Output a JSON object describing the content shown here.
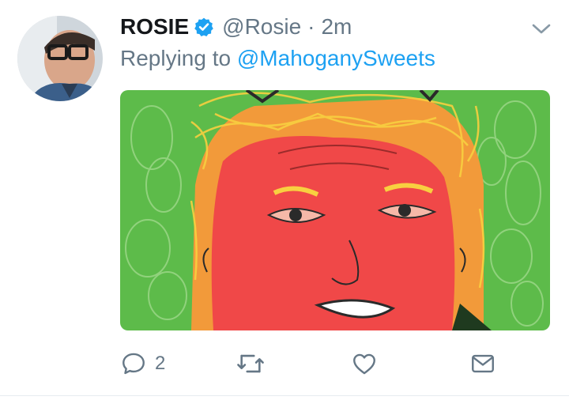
{
  "tweet": {
    "display_name": "ROSIE",
    "handle": "@Rosie",
    "separator": "·",
    "time": "2m",
    "replying_prefix": "Replying to ",
    "replying_to": "@MahoganySweets",
    "reply_count": "2",
    "icons": {
      "verified": "verified-badge-icon",
      "more": "chevron-down-icon",
      "reply": "reply-bubble-icon",
      "retweet": "retweet-icon",
      "like": "heart-icon",
      "dm": "envelope-icon"
    },
    "colors": {
      "link": "#1da1f2",
      "muted": "#657786",
      "text": "#14171a",
      "media_green": "#5dbb4a",
      "face_red": "#f04848",
      "hair_yellow": "#f5c030"
    }
  }
}
